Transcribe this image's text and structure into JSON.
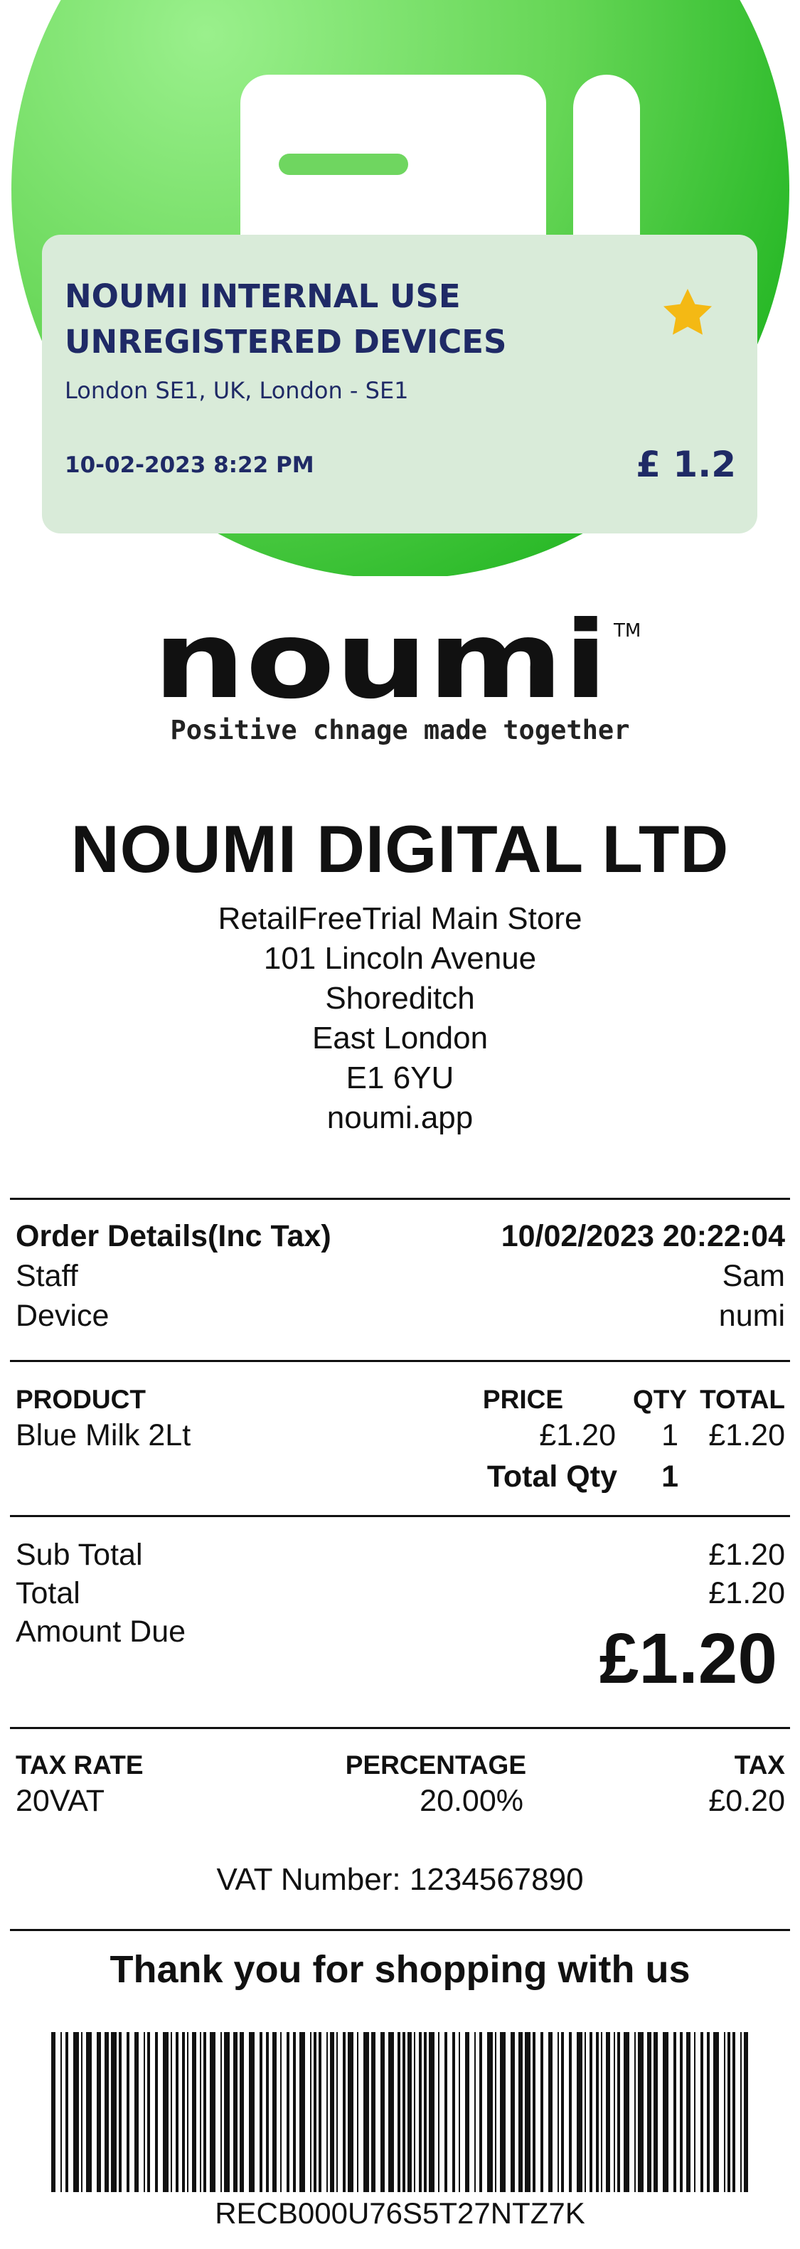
{
  "card": {
    "title": "NOUMI INTERNAL USE UNREGISTERED DEVICES",
    "address": "London SE1, UK, London - SE1",
    "datetime": "10-02-2023 8:22 PM",
    "amount": "£ 1.2",
    "favorite_icon": "star-icon",
    "star_color": "#f4b914"
  },
  "brand": {
    "logo_text": "noumi",
    "trademark": "TM",
    "tagline": "Positive chnage made together",
    "accent_green": "#27b826",
    "card_text_color": "#1f2a66"
  },
  "store": {
    "company": "NOUMI DIGITAL LTD",
    "address_lines": [
      "RetailFreeTrial Main Store",
      "101 Lincoln Avenue",
      "Shoreditch",
      "East London",
      "E1 6YU",
      "noumi.app"
    ]
  },
  "order": {
    "heading": "Order Details(Inc Tax)",
    "datetime": "10/02/2023 20:22:04",
    "staff_label": "Staff",
    "staff": "Sam",
    "device_label": "Device",
    "device": "numi"
  },
  "items": {
    "headers": {
      "product": "PRODUCT",
      "price": "PRICE",
      "qty": "QTY",
      "total": "TOTAL"
    },
    "rows": [
      {
        "product": "Blue Milk 2Lt",
        "price": "£1.20",
        "qty": "1",
        "total": "£1.20"
      }
    ],
    "total_qty_label": "Total Qty",
    "total_qty": "1"
  },
  "totals": {
    "subtotal_label": "Sub Total",
    "subtotal": "£1.20",
    "total_label": "Total",
    "total": "£1.20",
    "amount_due_label": "Amount Due",
    "amount_due": "£1.20"
  },
  "tax": {
    "headers": {
      "rate": "TAX RATE",
      "percentage": "PERCENTAGE",
      "tax": "TAX"
    },
    "rows": [
      {
        "rate": "20VAT",
        "percentage": "20.00%",
        "tax": "£0.20"
      }
    ]
  },
  "footer": {
    "vat_number": "VAT Number: 1234567890",
    "thanks": "Thank you for shopping with us",
    "barcode_text": "RECB000U76S5T27NTZ7K"
  }
}
